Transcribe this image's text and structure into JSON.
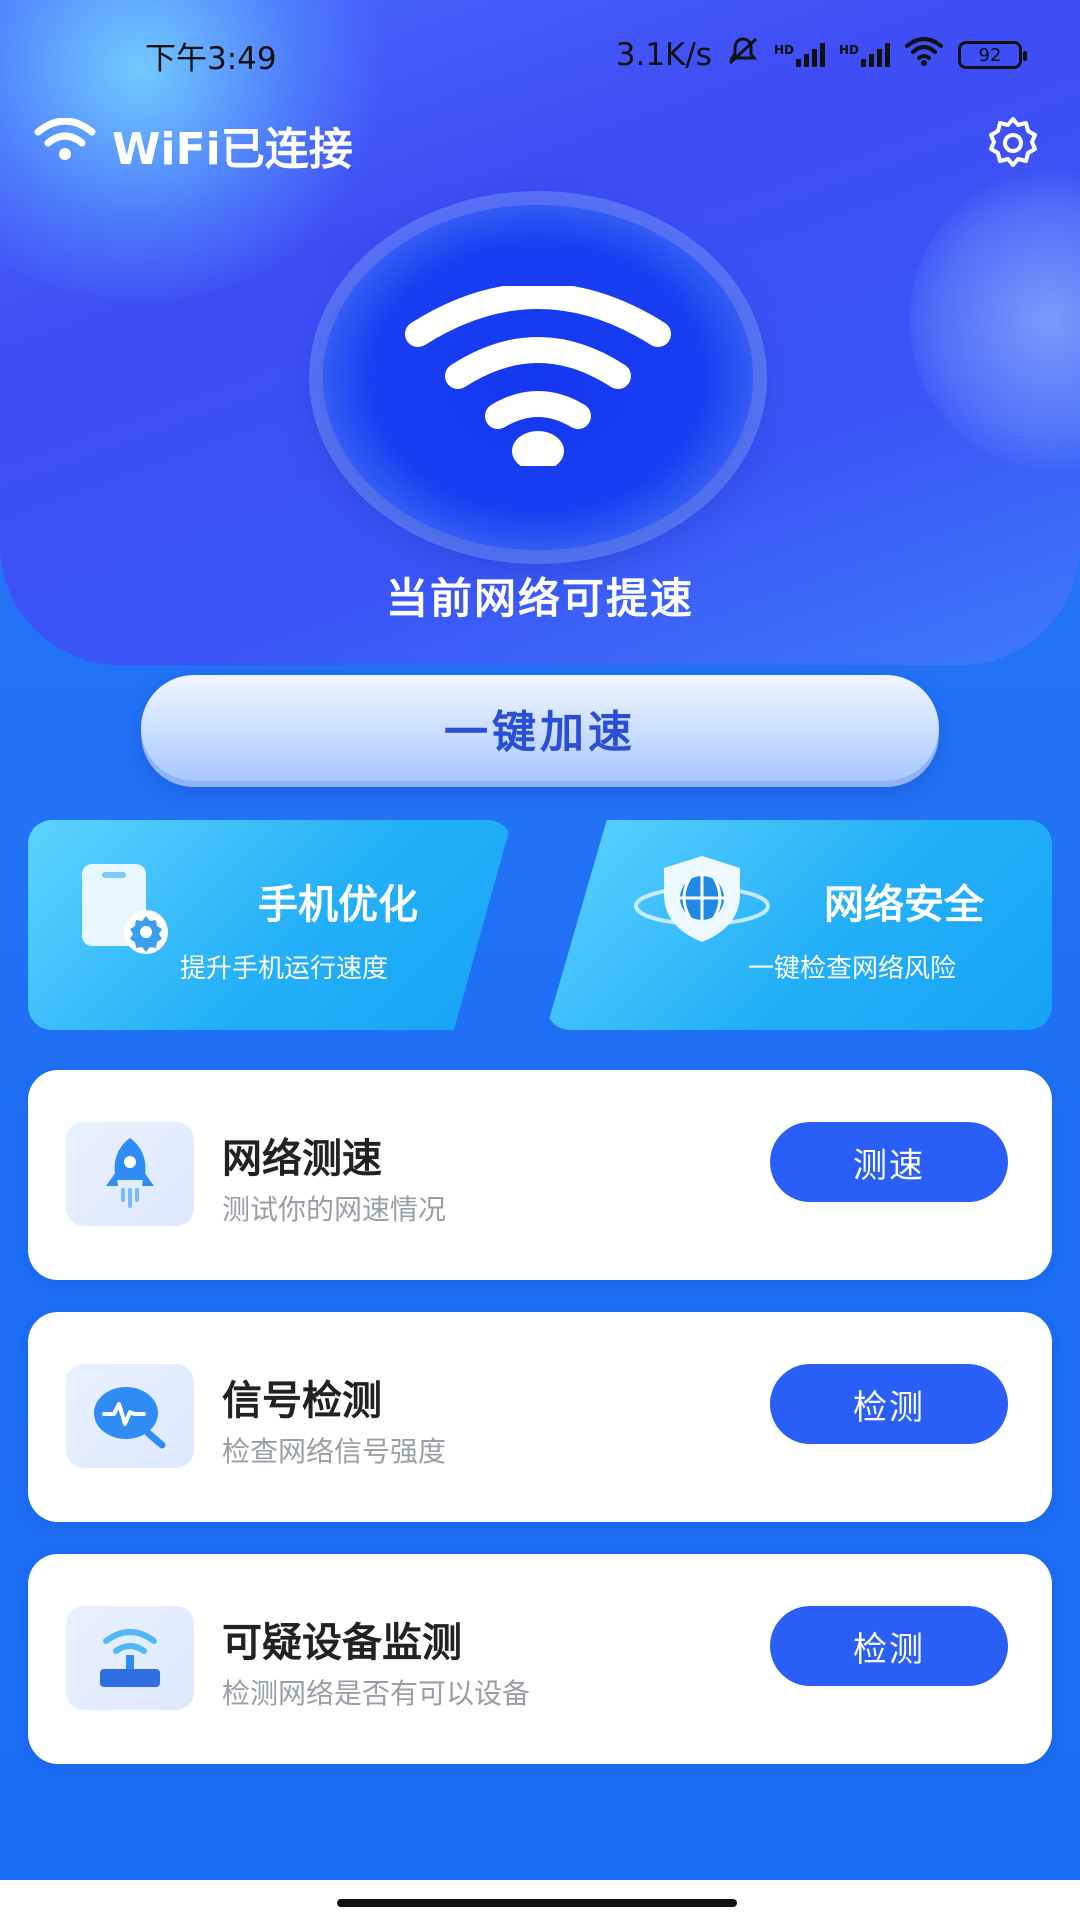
{
  "status_bar": {
    "time": "下午3:49",
    "net_speed": "3.1K/s",
    "battery": "92",
    "hd_label": "HD"
  },
  "app_bar": {
    "title": "WiFi已连接"
  },
  "hero": {
    "caption": "当前网络可提速"
  },
  "boost_button": {
    "label": "一键加速"
  },
  "features": [
    {
      "title": "手机优化",
      "subtitle": "提升手机运行速度",
      "icon": "phone-gear-icon"
    },
    {
      "title": "网络安全",
      "subtitle": "一键检查网络风险",
      "icon": "globe-shield-icon"
    }
  ],
  "tools": [
    {
      "title": "网络测速",
      "subtitle": "测试你的网速情况",
      "button": "测速",
      "icon": "rocket-icon"
    },
    {
      "title": "信号检测",
      "subtitle": "检查网络信号强度",
      "button": "检测",
      "icon": "signal-search-icon"
    },
    {
      "title": "可疑设备监测",
      "subtitle": "检测网络是否有可以设备",
      "button": "检测",
      "icon": "router-icon"
    }
  ],
  "colors": {
    "primary_button": "#2a5ff7",
    "background": "#1e6ff5",
    "feature_card": "#24b0f8"
  }
}
